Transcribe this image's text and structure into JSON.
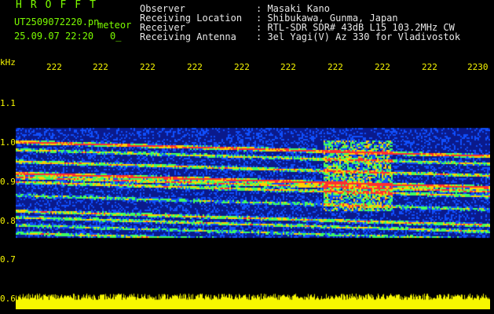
{
  "header": {
    "title": "HROFFT",
    "filename": "UT2509072220.pn",
    "tag": "meteor",
    "datetime": "25.09.07 22:20",
    "extra": "0_"
  },
  "info": [
    {
      "label": "Observer",
      "value": ": Masaki Kano"
    },
    {
      "label": "Receiving Location",
      "value": ": Shibukawa, Gunma, Japan"
    },
    {
      "label": "Receiver",
      "value": ": RTL-SDR SDR# 43dB L15 103.2MHz CW"
    },
    {
      "label": "Receiving Antenna",
      "value": ": 3el Yagi(V) Az 330 for Vladivostok"
    }
  ],
  "y_axis": {
    "unit": "kHz",
    "ticks": [
      "1.1",
      "1.0",
      "0.9",
      "0.8",
      "0.7",
      "0.6"
    ]
  },
  "x_axis": {
    "ticks": [
      "222",
      "222",
      "222",
      "222",
      "222",
      "222",
      "222",
      "222",
      "222",
      "2230"
    ]
  },
  "colors": {
    "background": "#000000",
    "header_title": "#7CFC00",
    "axis_labels": "#f7f700",
    "info_text": "#e8e8e8",
    "signal_low": "#0a1a8c",
    "signal_mid": "#00ff60",
    "signal_high": "#ff2020"
  }
}
